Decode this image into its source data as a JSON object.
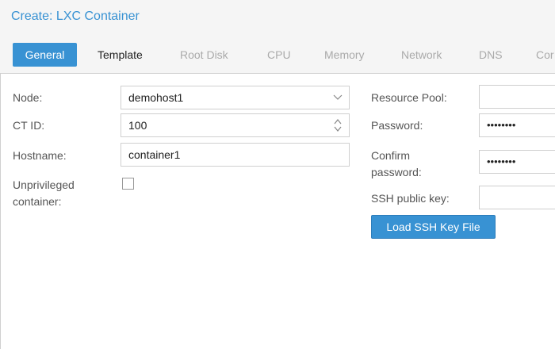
{
  "window": {
    "title": "Create: LXC Container"
  },
  "tabs": [
    {
      "label": "General",
      "state": "active"
    },
    {
      "label": "Template",
      "state": "enabled"
    },
    {
      "label": "Root Disk",
      "state": "disabled"
    },
    {
      "label": "CPU",
      "state": "disabled"
    },
    {
      "label": "Memory",
      "state": "disabled"
    },
    {
      "label": "Network",
      "state": "disabled"
    },
    {
      "label": "DNS",
      "state": "disabled"
    },
    {
      "label": "Cor",
      "state": "disabled"
    }
  ],
  "left": {
    "node": {
      "label": "Node:",
      "value": "demohost1"
    },
    "ctid": {
      "label": "CT ID:",
      "value": "100"
    },
    "hostname": {
      "label": "Hostname:",
      "value": "container1"
    },
    "unprivileged": {
      "label_line1": "Unprivileged",
      "label_line2": "container:",
      "checked": false
    }
  },
  "right": {
    "resource_pool": {
      "label": "Resource Pool:",
      "value": ""
    },
    "password": {
      "label": "Password:",
      "value": "••••••••"
    },
    "confirm_password": {
      "label_line1": "Confirm",
      "label_line2": "password:",
      "value": "••••••••"
    },
    "ssh_key": {
      "label": "SSH public key:",
      "value": ""
    },
    "load_button": "Load SSH Key File"
  },
  "colors": {
    "accent": "#3892d3",
    "disabled_tab": "#aaaaaa"
  },
  "icons": {
    "dropdown": "chevron-down-icon",
    "spinner": "spinner-arrows-icon"
  }
}
